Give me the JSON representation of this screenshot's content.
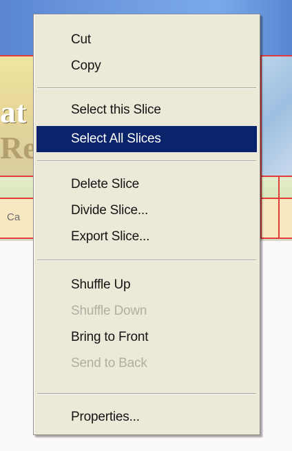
{
  "background": {
    "fragment_top": "at",
    "fragment_bottom": "Re",
    "tab_fragment": "Ca"
  },
  "context_menu": {
    "items": [
      {
        "label": "Cut",
        "enabled": true
      },
      {
        "label": "Copy",
        "enabled": true
      },
      {
        "label": "Select this Slice",
        "enabled": true
      },
      {
        "label": "Select All Slices",
        "enabled": true,
        "highlighted": true
      },
      {
        "label": "Delete Slice",
        "enabled": true
      },
      {
        "label": "Divide Slice...",
        "enabled": true
      },
      {
        "label": "Export Slice...",
        "enabled": true
      },
      {
        "label": "Shuffle Up",
        "enabled": true
      },
      {
        "label": "Shuffle Down",
        "enabled": false
      },
      {
        "label": "Bring to Front",
        "enabled": true
      },
      {
        "label": "Send to Back",
        "enabled": false
      },
      {
        "label": "Properties...",
        "enabled": true
      }
    ]
  },
  "colors": {
    "highlight": "#0b236a",
    "menu_background": "#ece9d8",
    "slice_line": "#e33a3a"
  }
}
